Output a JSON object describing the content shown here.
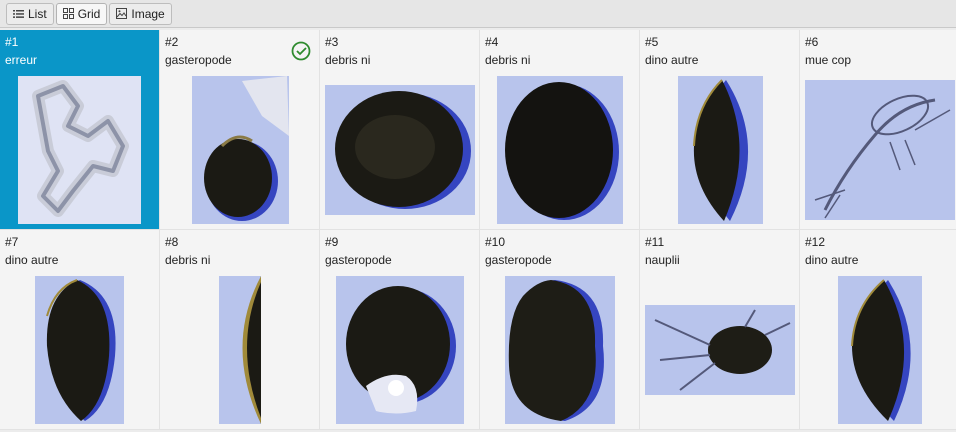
{
  "toolbar": {
    "tabs": [
      {
        "label": "List",
        "icon": "list-icon",
        "active": false
      },
      {
        "label": "Grid",
        "icon": "grid-icon",
        "active": true
      },
      {
        "label": "Image",
        "icon": "image-icon",
        "active": false
      }
    ]
  },
  "colors": {
    "selection": "#0a96c8",
    "check": "#2e8b2e",
    "thumb_background": "#b8c4ec",
    "specimen_dark": "#1b1a14"
  },
  "items": [
    {
      "number": "#1",
      "label": "erreur",
      "selected": true,
      "validated": false
    },
    {
      "number": "#2",
      "label": "gasteropode",
      "selected": false,
      "validated": true
    },
    {
      "number": "#3",
      "label": "debris ni",
      "selected": false,
      "validated": false
    },
    {
      "number": "#4",
      "label": "debris ni",
      "selected": false,
      "validated": false
    },
    {
      "number": "#5",
      "label": "dino autre",
      "selected": false,
      "validated": false
    },
    {
      "number": "#6",
      "label": "mue cop",
      "selected": false,
      "validated": false
    },
    {
      "number": "#7",
      "label": "dino autre",
      "selected": false,
      "validated": false
    },
    {
      "number": "#8",
      "label": "debris ni",
      "selected": false,
      "validated": false
    },
    {
      "number": "#9",
      "label": "gasteropode",
      "selected": false,
      "validated": false
    },
    {
      "number": "#10",
      "label": "gasteropode",
      "selected": false,
      "validated": false
    },
    {
      "number": "#11",
      "label": "nauplii",
      "selected": false,
      "validated": false
    },
    {
      "number": "#12",
      "label": "dino autre",
      "selected": false,
      "validated": false
    }
  ]
}
